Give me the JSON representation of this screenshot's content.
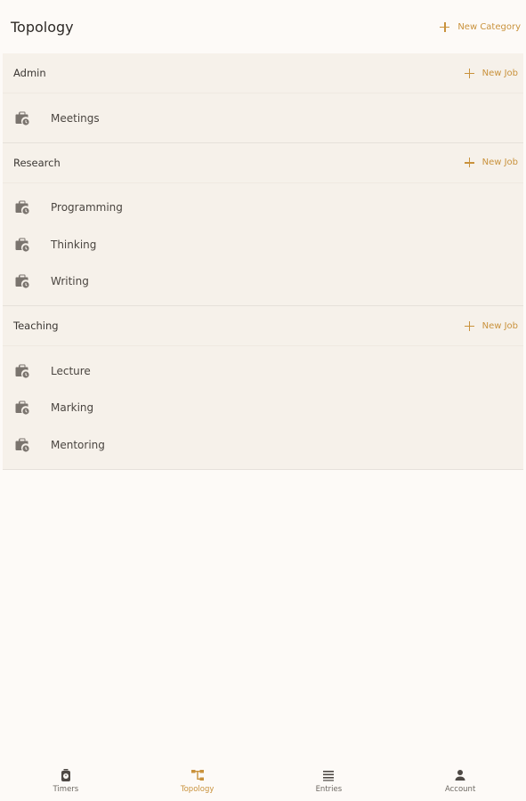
{
  "header": {
    "title": "Topology",
    "new_category_label": "New Category"
  },
  "categories": [
    {
      "name": "Admin",
      "new_job_label": "New Job",
      "jobs": [
        "Meetings"
      ]
    },
    {
      "name": "Research",
      "new_job_label": "New Job",
      "jobs": [
        "Programming",
        "Thinking",
        "Writing"
      ]
    },
    {
      "name": "Teaching",
      "new_job_label": "New Job",
      "jobs": [
        "Lecture",
        "Marking",
        "Mentoring"
      ]
    }
  ],
  "bottom_nav": [
    {
      "label": "Timers",
      "icon": "timer-icon",
      "active": false
    },
    {
      "label": "Topology",
      "icon": "topology-icon",
      "active": true
    },
    {
      "label": "Entries",
      "icon": "list-icon",
      "active": false
    },
    {
      "label": "Account",
      "icon": "person-icon",
      "active": false
    }
  ],
  "colors": {
    "accent": "#c9923c",
    "background": "#fdfaf7",
    "category_bg": "#f6f1ea",
    "icon_gray": "#7a746e"
  }
}
